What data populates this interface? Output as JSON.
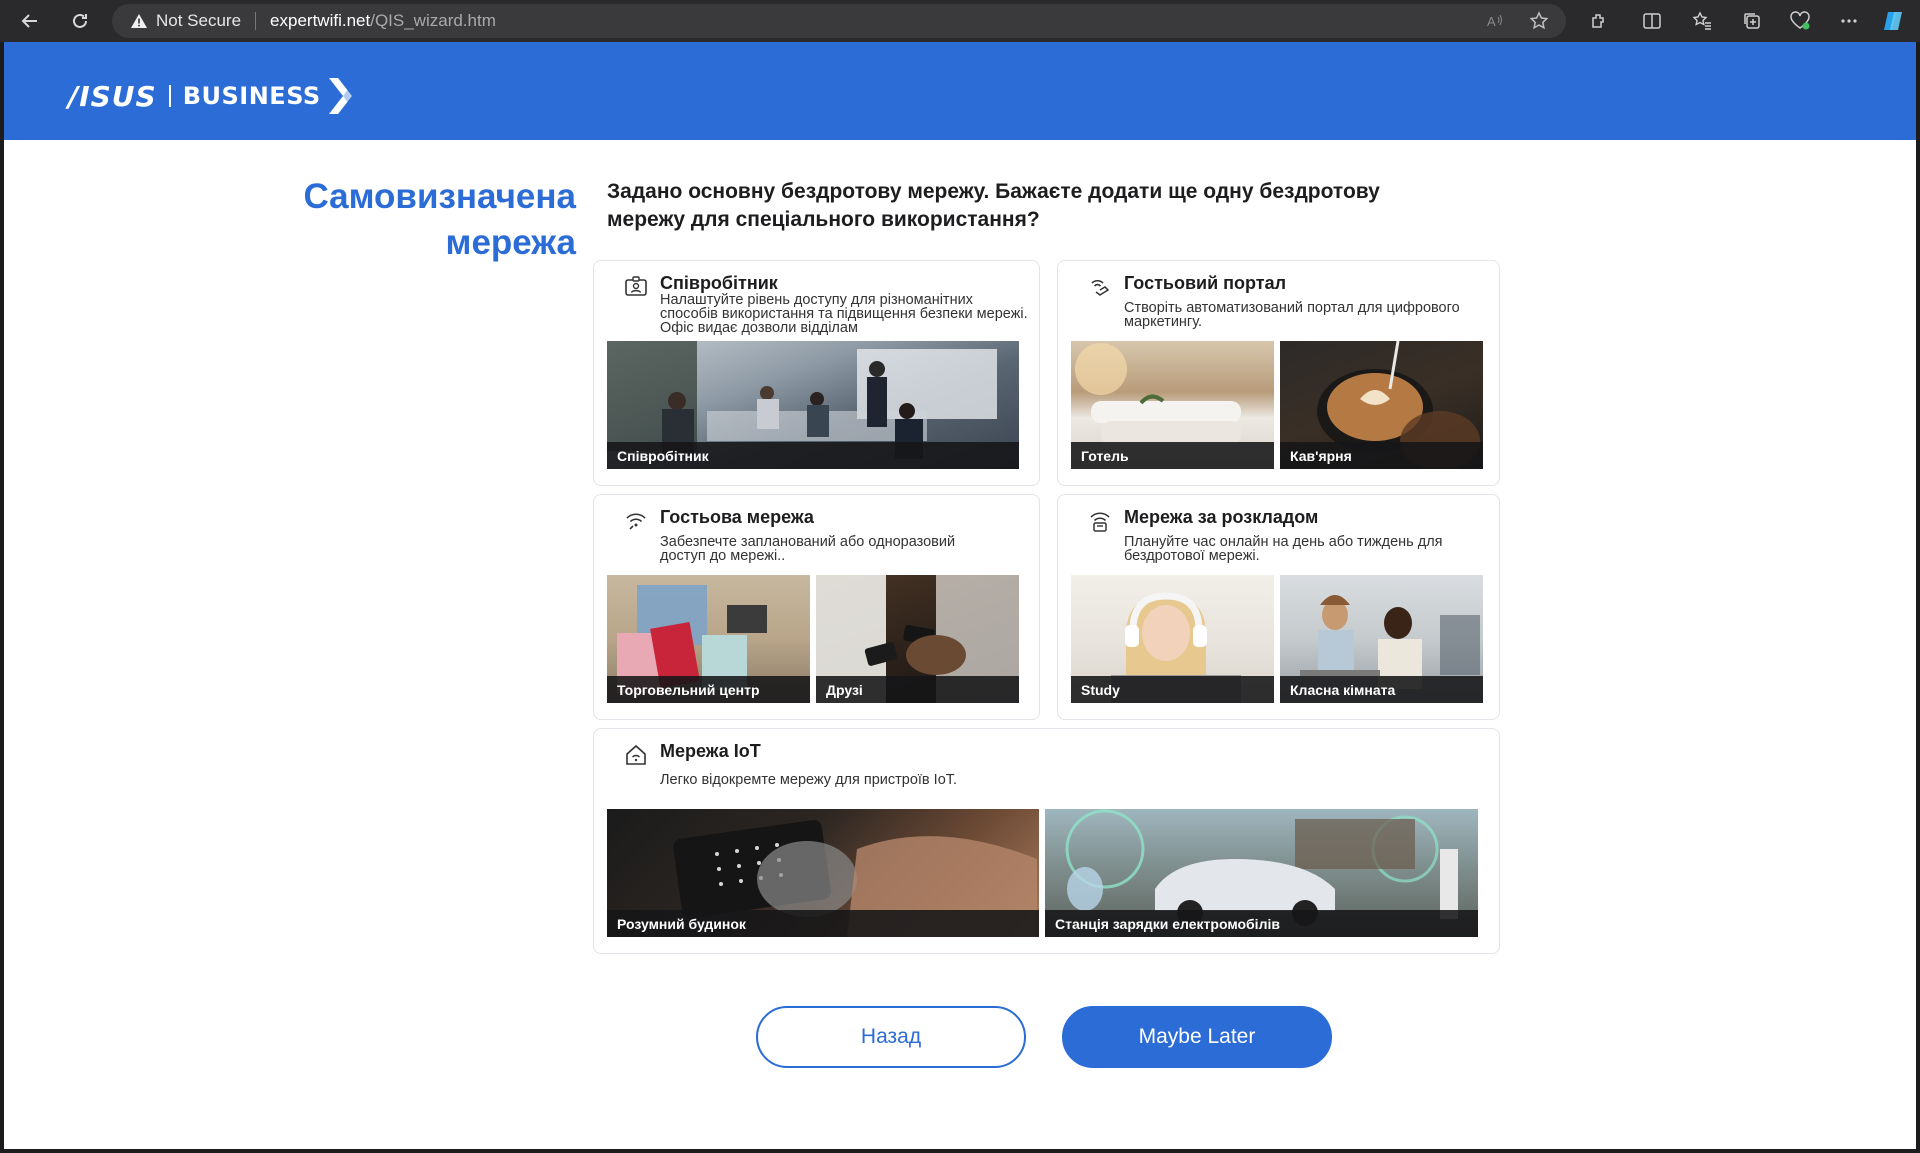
{
  "browser": {
    "security_label": "Not Secure",
    "url_host": "expertwifi.net",
    "url_path": "/QIS_wizard.htm"
  },
  "brand": {
    "logo_left": "/ISUS",
    "logo_right": "BUSINESS"
  },
  "page_title": "Самовизначена мережа",
  "headline": "Задано основну бездротову мережу. Бажаєте додати ще одну бездротову мережу для спеціального використання?",
  "cards": {
    "employee": {
      "title": "Співробітник",
      "desc": "Налаштуйте рівень доступу для різноманітних способів використання та підвищення безпеки мережі. Офіс видає дозволи відділам",
      "images": [
        "Співробітник"
      ]
    },
    "guest_portal": {
      "title": "Гостьовий портал",
      "desc": "Створіть автоматизований портал для цифрового маркетингу.",
      "images": [
        "Готель",
        "Кав'ярня"
      ]
    },
    "guest_network": {
      "title": "Гостьова мережа",
      "desc": "Забезпечте запланований або одноразовий доступ до мережі..",
      "images": [
        "Торговельний центр",
        "Друзі"
      ]
    },
    "scheduled": {
      "title": "Мережа за розкладом",
      "desc": "Плануйте час онлайн на день або тиждень для бездротової мережі.",
      "images": [
        "Study",
        "Класна кімната"
      ]
    },
    "iot": {
      "title": "Мережа IoT",
      "desc": "Легко відокремте мережу для пристроїв IoT.",
      "images": [
        "Розумний будинок",
        "Станція зарядки електромобілів"
      ]
    }
  },
  "buttons": {
    "back": "Назад",
    "later": "Maybe Later"
  },
  "colors": {
    "brand_blue": "#2c6cd6",
    "chrome_bg": "#2a2a2d"
  }
}
